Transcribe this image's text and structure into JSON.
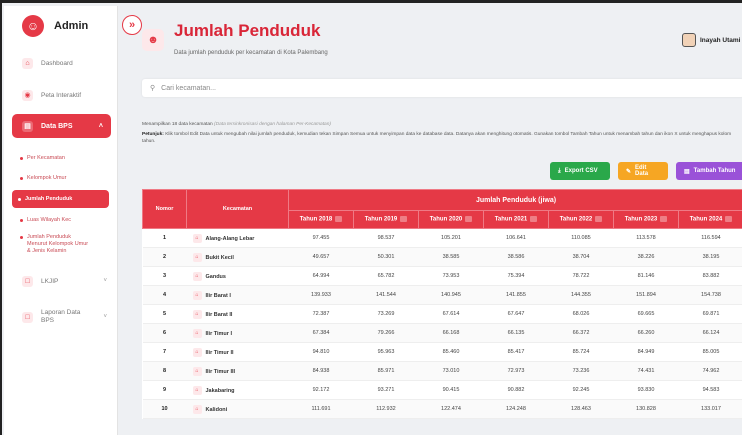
{
  "brand": {
    "name": "Admin"
  },
  "sidebar": {
    "items": [
      {
        "label": "Dashboard",
        "icon": "home-icon"
      },
      {
        "label": "Peta Interaktif",
        "icon": "map-pin-icon"
      },
      {
        "label": "Data BPS",
        "icon": "chart-icon"
      },
      {
        "label": "LKJIP",
        "icon": "document-icon"
      },
      {
        "label": "Laporan Data BPS",
        "icon": "report-icon"
      }
    ],
    "sub": [
      "Per Kecamatan",
      "Kelompok Umur",
      "Jumlah Penduduk",
      "Luas Wilayah Kec",
      "Jumlah Penduduk Menurut Kelompok Umur & Jenis Kelamin"
    ]
  },
  "header": {
    "title": "Jumlah Penduduk",
    "subtitle": "Data jumlah penduduk per kecamatan di Kota Palembang",
    "user": "Inayah Utami"
  },
  "search": {
    "placeholder": "Cari kecamatan..."
  },
  "info": {
    "showing": "Menampilkan 18 data kecamatan",
    "note": "(Data tersinkronisasi dengan halaman Per-Kecamatan)",
    "tip_label": "Petunjuk:",
    "tip": "Klik tombol Edit Data untuk mengubah nilai jumlah penduduk, kemudian tekan Simpan Semua untuk menyimpan data ke database data. Datanya akan menghitung otomatis. Gunakan tombol Tambah Tahun untuk menambah tahun dan ikon X untuk menghapus kolom tahun."
  },
  "buttons": {
    "export": "Export CSV",
    "edit": "Edit Data",
    "add": "Tambah Tahun"
  },
  "table": {
    "col_no": "Nomor",
    "col_kec": "Kecamatan",
    "group": "Jumlah Penduduk (jiwa)",
    "years": [
      "Tahun 2018",
      "Tahun 2019",
      "Tahun 2020",
      "Tahun 2021",
      "Tahun 2022",
      "Tahun 2023",
      "Tahun 2024"
    ],
    "rows": [
      {
        "no": "1",
        "kec": "Alang-Alang Lebar",
        "v": [
          "97.455",
          "98.537",
          "105.201",
          "106.641",
          "110.085",
          "113.578",
          "116.594"
        ]
      },
      {
        "no": "2",
        "kec": "Bukit Kecil",
        "v": [
          "49.657",
          "50.301",
          "38.585",
          "38.586",
          "38.704",
          "38.226",
          "38.195"
        ]
      },
      {
        "no": "3",
        "kec": "Gandus",
        "v": [
          "64.994",
          "65.782",
          "73.953",
          "75.394",
          "78.722",
          "81.146",
          "83.882"
        ]
      },
      {
        "no": "4",
        "kec": "Ilir Barat I",
        "v": [
          "139.933",
          "141.544",
          "140.945",
          "141.855",
          "144.355",
          "151.894",
          "154.738"
        ]
      },
      {
        "no": "5",
        "kec": "Ilir Barat II",
        "v": [
          "72.387",
          "73.269",
          "67.614",
          "67.647",
          "68.026",
          "69.665",
          "69.871"
        ]
      },
      {
        "no": "6",
        "kec": "Ilir Timur I",
        "v": [
          "67.384",
          "79.266",
          "66.168",
          "66.135",
          "66.372",
          "66.260",
          "66.124"
        ]
      },
      {
        "no": "7",
        "kec": "Ilir Timur II",
        "v": [
          "94.810",
          "95.963",
          "85.460",
          "85.417",
          "85.724",
          "84.949",
          "85.005"
        ]
      },
      {
        "no": "8",
        "kec": "Ilir Timur III",
        "v": [
          "84.938",
          "85.971",
          "73.010",
          "72.973",
          "73.236",
          "74.431",
          "74.962"
        ]
      },
      {
        "no": "9",
        "kec": "Jakabaring",
        "v": [
          "92.172",
          "93.271",
          "90.415",
          "90.882",
          "92.245",
          "93.830",
          "94.583"
        ]
      },
      {
        "no": "10",
        "kec": "Kalidoni",
        "v": [
          "111.691",
          "112.932",
          "122.474",
          "124.248",
          "128.463",
          "130.828",
          "133.017"
        ]
      }
    ]
  }
}
